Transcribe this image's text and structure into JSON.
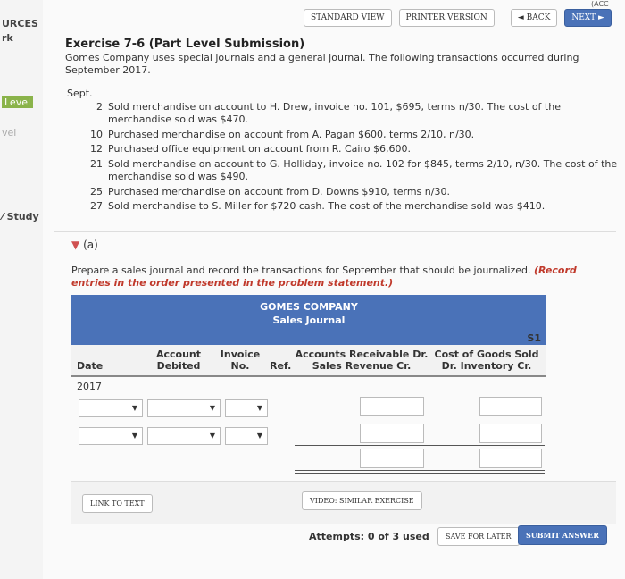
{
  "nav": {
    "standard_view": "STANDARD VIEW",
    "printer_version": "PRINTER VERSION",
    "back": "◄ BACK",
    "next": "NEXT ►",
    "acc_tab": "(ACC"
  },
  "left": {
    "resources": "URCES",
    "work": "rk",
    "level1": "Level",
    "level2": "vel",
    "study": "Study"
  },
  "exercise": {
    "title": "Exercise 7-6 (Part Level Submission)",
    "intro": "Gomes Company uses special journals and a general journal. The following transactions occurred during September 2017.",
    "month": "Sept.",
    "transactions": [
      {
        "day": "2",
        "text": "Sold merchandise on account to H. Drew, invoice no. 101, $695, terms n/30. The cost of the merchandise sold was $470."
      },
      {
        "day": "10",
        "text": "Purchased merchandise on account from A. Pagan $600, terms 2/10, n/30."
      },
      {
        "day": "12",
        "text": "Purchased office equipment on account from R. Cairo $6,600."
      },
      {
        "day": "21",
        "text": "Sold merchandise on account to G. Holliday, invoice no. 102 for $845, terms 2/10, n/30. The cost of the merchandise sold was $490."
      },
      {
        "day": "25",
        "text": "Purchased merchandise on account from D. Downs $910, terms n/30."
      },
      {
        "day": "27",
        "text": "Sold merchandise to S. Miller for $720 cash. The cost of the merchandise sold was $410."
      }
    ]
  },
  "part_a": {
    "label": "(a)",
    "instruction": "Prepare a sales journal and record the transactions for September that should be journalized.",
    "instruction_red": "(Record entries in the order presented in the problem statement.)"
  },
  "journal": {
    "company": "GOMES COMPANY",
    "name": "Sales Journal",
    "page": "S1",
    "col_date": "Date",
    "col_account": "Account Debited",
    "col_invoice": "Invoice No.",
    "col_ref": "Ref.",
    "col_ar": "Accounts Receivable Dr. Sales Revenue Cr.",
    "col_cogs": "Cost of Goods Sold Dr. Inventory Cr.",
    "year": "2017"
  },
  "footer": {
    "link_to_text": "LINK TO TEXT",
    "video": "VIDEO: SIMILAR EXERCISE",
    "attempts": "Attempts: 0 of 3 used",
    "save": "SAVE FOR LATER",
    "submit": "SUBMIT ANSWER"
  }
}
